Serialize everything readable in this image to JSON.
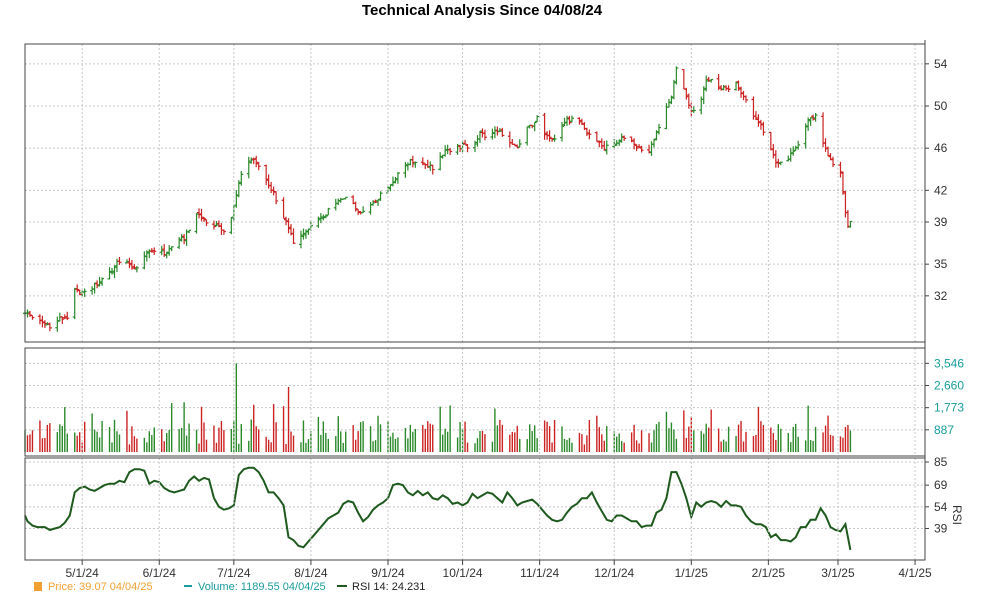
{
  "chart_data": {
    "type": "line",
    "title": "Technical Analysis Since 04/08/24",
    "x_ticks": [
      "5/1/24",
      "6/1/24",
      "7/1/24",
      "8/1/24",
      "9/1/24",
      "10/1/24",
      "11/1/24",
      "12/1/24",
      "1/1/25",
      "2/1/25",
      "3/1/25",
      "4/1/25"
    ],
    "x_tick_days": [
      23,
      54,
      84,
      115,
      146,
      176,
      207,
      237,
      268,
      299,
      327,
      358
    ],
    "price_axis": {
      "ticks": [
        "54",
        "50",
        "46",
        "42",
        "39",
        "35",
        "32"
      ],
      "values": [
        54,
        50,
        46,
        42,
        39,
        35,
        32
      ],
      "ylim": [
        28,
        55.5
      ]
    },
    "volume_axis": {
      "ticks": [
        "3,546",
        "2,660",
        "1,773",
        "887"
      ],
      "values": [
        3546,
        2660,
        1773,
        887
      ],
      "ylim": [
        0,
        4000
      ]
    },
    "rsi_axis": {
      "ticks": [
        "85",
        "69",
        "54",
        "39"
      ],
      "values": [
        85,
        69,
        54,
        39
      ],
      "ylim": [
        20,
        85
      ],
      "label": "RSI"
    },
    "series": [
      {
        "name": "Price",
        "kind": "ohlc",
        "colors": {
          "up": "#2a8a2a",
          "down": "#cc2222"
        },
        "points": [
          [
            0,
            30.5
          ],
          [
            5,
            29.6
          ],
          [
            10,
            29.2
          ],
          [
            14,
            29.8
          ],
          [
            17,
            30.0
          ],
          [
            20,
            32.5
          ],
          [
            24,
            32.2
          ],
          [
            28,
            33.0
          ],
          [
            33,
            34.0
          ],
          [
            38,
            35.3
          ],
          [
            42,
            35.0
          ],
          [
            45,
            34.5
          ],
          [
            48,
            35.8
          ],
          [
            52,
            36.3
          ],
          [
            56,
            36.0
          ],
          [
            60,
            36.8
          ],
          [
            64,
            37.5
          ],
          [
            69,
            39.8
          ],
          [
            74,
            39.0
          ],
          [
            78,
            38.4
          ],
          [
            82,
            38.2
          ],
          [
            85,
            41.5
          ],
          [
            88,
            44.8
          ],
          [
            91,
            45.0
          ],
          [
            94,
            44.2
          ],
          [
            97,
            42.8
          ],
          [
            100,
            41.8
          ],
          [
            104,
            39.5
          ],
          [
            106,
            38.3
          ],
          [
            108,
            37.2
          ],
          [
            112,
            37.9
          ],
          [
            116,
            38.6
          ],
          [
            120,
            39.5
          ],
          [
            124,
            40.5
          ],
          [
            129,
            41.5
          ],
          [
            134,
            40.0
          ],
          [
            138,
            40.5
          ],
          [
            143,
            41.5
          ],
          [
            147,
            42.5
          ],
          [
            152,
            44.5
          ],
          [
            157,
            44.8
          ],
          [
            161,
            44.5
          ],
          [
            165,
            44.0
          ],
          [
            168,
            45.5
          ],
          [
            172,
            46.0
          ],
          [
            176,
            46.2
          ],
          [
            180,
            46.0
          ],
          [
            183,
            47.5
          ],
          [
            186,
            47.0
          ],
          [
            190,
            47.8
          ],
          [
            194,
            46.5
          ],
          [
            198,
            46.0
          ],
          [
            202,
            47.8
          ],
          [
            206,
            48.8
          ],
          [
            209,
            47.5
          ],
          [
            213,
            47.0
          ],
          [
            217,
            48.5
          ],
          [
            222,
            48.8
          ],
          [
            226,
            47.5
          ],
          [
            230,
            46.8
          ],
          [
            233,
            46.0
          ],
          [
            237,
            46.5
          ],
          [
            240,
            46.8
          ],
          [
            244,
            46.5
          ],
          [
            247,
            46.0
          ],
          [
            251,
            45.8
          ],
          [
            254,
            47.5
          ],
          [
            257,
            49.0
          ],
          [
            260,
            51.0
          ],
          [
            262,
            53.5
          ],
          [
            265,
            51.5
          ],
          [
            268,
            49.5
          ],
          [
            271,
            50.0
          ],
          [
            274,
            52.5
          ],
          [
            277,
            52.3
          ],
          [
            280,
            51.5
          ],
          [
            283,
            51.8
          ],
          [
            286,
            52.0
          ],
          [
            289,
            51.0
          ],
          [
            292,
            49.5
          ],
          [
            296,
            48.2
          ],
          [
            299,
            46.5
          ],
          [
            302,
            44.5
          ],
          [
            305,
            44.8
          ],
          [
            309,
            45.5
          ],
          [
            312,
            47.0
          ],
          [
            315,
            48.5
          ],
          [
            318,
            49.0
          ],
          [
            321,
            46.5
          ],
          [
            323,
            45.5
          ],
          [
            325,
            44.5
          ],
          [
            327,
            45.5
          ],
          [
            329,
            41.5
          ],
          [
            331,
            38.5
          ],
          [
            332,
            39.07
          ]
        ]
      },
      {
        "name": "Volume",
        "kind": "bar",
        "last_value": "1189.55",
        "last_date": "04/04/25",
        "peaks": [
          [
            85,
            3546
          ],
          [
            106,
            2600
          ]
        ],
        "typical_range": [
          300,
          1300
        ]
      },
      {
        "name": "RSI 14",
        "kind": "line",
        "color": "#1e5a1e",
        "last_value": "24.231",
        "points": [
          [
            0,
            48
          ],
          [
            1,
            44
          ],
          [
            3,
            41
          ],
          [
            5,
            40
          ],
          [
            8,
            40
          ],
          [
            10,
            38
          ],
          [
            12,
            39
          ],
          [
            14,
            40
          ],
          [
            16,
            43
          ],
          [
            18,
            48
          ],
          [
            20,
            64
          ],
          [
            22,
            67
          ],
          [
            24,
            68
          ],
          [
            26,
            66
          ],
          [
            28,
            65
          ],
          [
            30,
            67
          ],
          [
            32,
            69
          ],
          [
            34,
            70
          ],
          [
            36,
            70
          ],
          [
            38,
            72
          ],
          [
            40,
            71
          ],
          [
            42,
            78
          ],
          [
            44,
            80
          ],
          [
            46,
            80
          ],
          [
            48,
            79
          ],
          [
            50,
            70
          ],
          [
            52,
            72
          ],
          [
            54,
            71
          ],
          [
            56,
            67
          ],
          [
            58,
            65
          ],
          [
            60,
            64
          ],
          [
            62,
            65
          ],
          [
            64,
            66
          ],
          [
            66,
            72
          ],
          [
            68,
            75
          ],
          [
            70,
            72
          ],
          [
            72,
            74
          ],
          [
            74,
            73
          ],
          [
            76,
            60
          ],
          [
            78,
            54
          ],
          [
            80,
            52
          ],
          [
            82,
            53
          ],
          [
            84,
            55
          ],
          [
            86,
            76
          ],
          [
            88,
            80
          ],
          [
            90,
            81
          ],
          [
            92,
            81
          ],
          [
            94,
            78
          ],
          [
            96,
            72
          ],
          [
            98,
            64
          ],
          [
            100,
            64
          ],
          [
            102,
            60
          ],
          [
            104,
            55
          ],
          [
            106,
            33
          ],
          [
            108,
            31
          ],
          [
            110,
            27
          ],
          [
            112,
            26
          ],
          [
            114,
            30
          ],
          [
            116,
            34
          ],
          [
            118,
            38
          ],
          [
            120,
            42
          ],
          [
            122,
            46
          ],
          [
            124,
            48
          ],
          [
            126,
            50
          ],
          [
            128,
            56
          ],
          [
            130,
            58
          ],
          [
            132,
            57
          ],
          [
            134,
            50
          ],
          [
            136,
            44
          ],
          [
            138,
            47
          ],
          [
            140,
            52
          ],
          [
            142,
            55
          ],
          [
            144,
            57
          ],
          [
            146,
            60
          ],
          [
            148,
            69
          ],
          [
            150,
            70
          ],
          [
            152,
            69
          ],
          [
            154,
            64
          ],
          [
            156,
            62
          ],
          [
            158,
            65
          ],
          [
            160,
            62
          ],
          [
            162,
            64
          ],
          [
            164,
            60
          ],
          [
            166,
            59
          ],
          [
            168,
            62
          ],
          [
            170,
            60
          ],
          [
            172,
            56
          ],
          [
            174,
            57
          ],
          [
            176,
            55
          ],
          [
            178,
            57
          ],
          [
            180,
            63
          ],
          [
            182,
            60
          ],
          [
            184,
            62
          ],
          [
            186,
            64
          ],
          [
            188,
            63
          ],
          [
            190,
            60
          ],
          [
            192,
            57
          ],
          [
            194,
            64
          ],
          [
            196,
            60
          ],
          [
            198,
            55
          ],
          [
            200,
            57
          ],
          [
            202,
            58
          ],
          [
            204,
            59
          ],
          [
            206,
            56
          ],
          [
            208,
            52
          ],
          [
            210,
            48
          ],
          [
            212,
            45
          ],
          [
            214,
            44
          ],
          [
            216,
            45
          ],
          [
            218,
            50
          ],
          [
            220,
            54
          ],
          [
            222,
            56
          ],
          [
            224,
            60
          ],
          [
            226,
            60
          ],
          [
            228,
            64
          ],
          [
            230,
            57
          ],
          [
            232,
            51
          ],
          [
            234,
            45
          ],
          [
            236,
            44
          ],
          [
            238,
            48
          ],
          [
            240,
            48
          ],
          [
            242,
            46
          ],
          [
            244,
            44
          ],
          [
            246,
            44
          ],
          [
            248,
            40
          ],
          [
            250,
            41
          ],
          [
            252,
            41
          ],
          [
            254,
            50
          ],
          [
            256,
            52
          ],
          [
            258,
            60
          ],
          [
            260,
            78
          ],
          [
            262,
            78
          ],
          [
            264,
            70
          ],
          [
            266,
            60
          ],
          [
            268,
            47
          ],
          [
            270,
            57
          ],
          [
            272,
            54
          ],
          [
            274,
            57
          ],
          [
            276,
            58
          ],
          [
            278,
            57
          ],
          [
            280,
            54
          ],
          [
            282,
            58
          ],
          [
            284,
            55
          ],
          [
            286,
            55
          ],
          [
            288,
            54
          ],
          [
            290,
            48
          ],
          [
            292,
            44
          ],
          [
            294,
            42
          ],
          [
            296,
            42
          ],
          [
            298,
            40
          ],
          [
            300,
            33
          ],
          [
            302,
            35
          ],
          [
            304,
            31
          ],
          [
            306,
            31
          ],
          [
            308,
            30
          ],
          [
            310,
            33
          ],
          [
            312,
            40
          ],
          [
            314,
            40
          ],
          [
            316,
            45
          ],
          [
            318,
            45
          ],
          [
            320,
            53
          ],
          [
            322,
            48
          ],
          [
            324,
            40
          ],
          [
            326,
            38
          ],
          [
            328,
            37
          ],
          [
            330,
            42
          ],
          [
            332,
            24.231
          ]
        ]
      }
    ],
    "legend": {
      "price_label": "Price: 39.07  04/04/25",
      "volume_label": "Volume: 1189.55  04/04/25",
      "rsi_label": "RSI 14: 24.231",
      "colors": {
        "price": "#f0a030",
        "volume": "#1a9c9c",
        "rsi": "#1e5a1e"
      }
    },
    "grid": true
  }
}
